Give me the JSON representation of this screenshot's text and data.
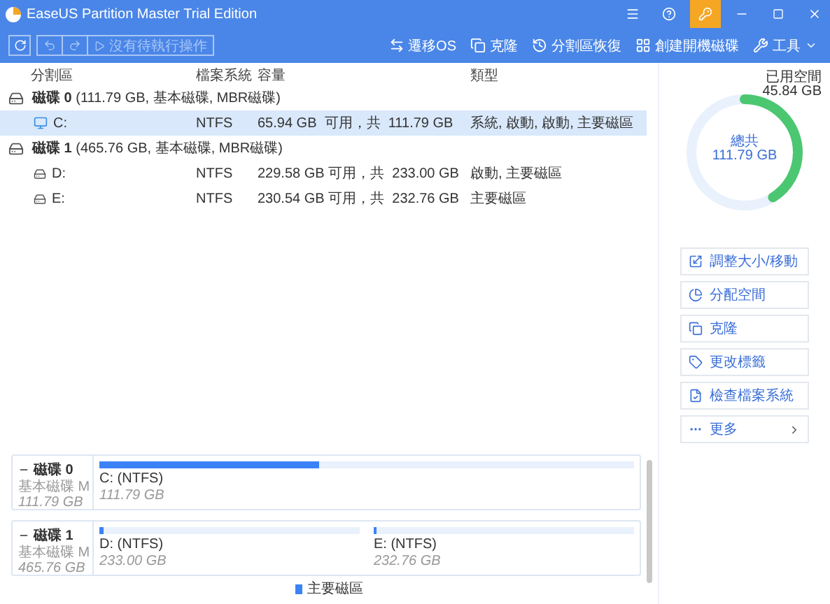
{
  "window": {
    "title": "EaseUS Partition Master Trial Edition",
    "license_highlighted": true
  },
  "toolbar": {
    "pending": "沒有待執行操作",
    "pending_disabled": true,
    "actions": [
      {
        "kind": "migrate",
        "label": "遷移OS"
      },
      {
        "kind": "clone",
        "label": "克隆"
      },
      {
        "kind": "recover",
        "label": "分割區恢復"
      },
      {
        "kind": "bootdisk",
        "label": "創建開機磁碟"
      },
      {
        "kind": "tools",
        "label": "工具"
      }
    ]
  },
  "table": {
    "columns": [
      "分割區",
      "檔案系統",
      "容量",
      "類型"
    ],
    "rows": [
      {
        "kind": "disk",
        "label": "**磁碟 0** (111.79 GB, 基本磁碟, MBR磁碟)"
      },
      {
        "kind": "system",
        "name": "C:",
        "fs": "NTFS",
        "capacity": "65.94 GB  可用，共  111.79 GB",
        "type": "系統, 啟動, 啟動, 主要磁區",
        "selected": true
      },
      {
        "kind": "disk",
        "label": "**磁碟 1** (465.76 GB, 基本磁碟, MBR磁碟)"
      },
      {
        "kind": "partition",
        "name": "D:",
        "fs": "NTFS",
        "capacity": "229.58 GB 可用，共  233.00 GB",
        "type": "啟動, 主要磁區",
        "selected": false
      },
      {
        "kind": "partition",
        "name": "E:",
        "fs": "NTFS",
        "capacity": "230.54 GB 可用，共  232.76 GB",
        "type": "主要磁區",
        "selected": false
      }
    ]
  },
  "usage": {
    "used_label": "已用空間",
    "used": "45.84 GB",
    "total_label": "總共",
    "total": "111.79 GB",
    "level": 0.41
  },
  "actions": [
    {
      "kind": "resize",
      "label": "調整大小/移動"
    },
    {
      "kind": "allocate",
      "label": "分配空間"
    },
    {
      "kind": "clone",
      "label": "克隆"
    },
    {
      "kind": "label",
      "label": "更改標籤"
    },
    {
      "kind": "check",
      "label": "檢查檔案系統"
    },
    {
      "kind": "more",
      "label": "更多"
    }
  ],
  "disk_map": [
    {
      "name": "磁碟 0",
      "type": "基本磁碟 M",
      "size": "111.79 GB",
      "partitions": [
        {
          "label": "C: (NTFS)",
          "size": "111.79 GB",
          "level": 0.41
        }
      ]
    },
    {
      "name": "磁碟 1",
      "type": "基本磁碟 M",
      "size": "465.76 GB",
      "partitions": [
        {
          "label": "D: (NTFS)",
          "size": "233.00 GB",
          "level": 0.015
        },
        {
          "label": "E: (NTFS)",
          "size": "232.76 GB",
          "level": 0.01
        }
      ]
    }
  ],
  "legend": [
    {
      "label": "主要磁區",
      "color": "#3b82f6"
    }
  ]
}
